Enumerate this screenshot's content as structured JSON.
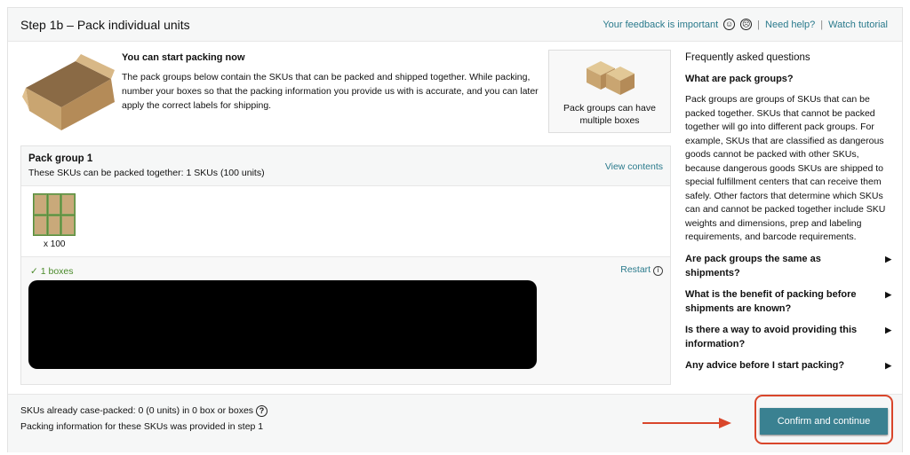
{
  "header": {
    "title": "Step 1b – Pack individual units",
    "feedback": "Your feedback is important",
    "need_help": "Need help?",
    "watch_tutorial": "Watch tutorial",
    "separator": "|"
  },
  "intro": {
    "heading": "You can start packing now",
    "body": "The pack groups below contain the SKUs that can be packed and shipped together. While packing, number your boxes so that the packing information you provide us with is accurate, and you can later apply the correct labels for shipping."
  },
  "tip": {
    "text": "Pack groups can have multiple boxes"
  },
  "faq": {
    "heading": "Frequently asked questions",
    "open_question": "What are pack groups?",
    "answer": "Pack groups are groups of SKUs that can be packed together. SKUs that cannot be packed together will go into different pack groups. For example, SKUs that are classified as dangerous goods cannot be packed with other SKUs, because dangerous goods SKUs are shipped to special fulfillment centers that can receive them safely. Other factors that determine which SKUs can and cannot be packed together include SKU weights and dimensions, prep and labeling requirements, and barcode requirements.",
    "questions": [
      "Are pack groups the same as shipments?",
      "What is the benefit of packing before shipments are known?",
      "Is there a way to avoid providing this information?",
      "Any advice before I start packing?"
    ]
  },
  "pack_group": {
    "title": "Pack group 1",
    "subtitle": "These SKUs can be packed together: 1 SKUs (100 units)",
    "view_contents": "View contents",
    "quantity": "x 100",
    "boxes_status": "1 boxes",
    "restart": "Restart"
  },
  "footer": {
    "case_packed": "SKUs already case-packed: 0 (0 units) in 0 box or boxes",
    "provided": "Packing information for these SKUs was provided in step 1",
    "confirm": "Confirm and continue"
  },
  "colors": {
    "link": "#2a7a8c",
    "button": "#3a8191",
    "highlight": "#d9462b",
    "success": "#4a8a2a"
  }
}
